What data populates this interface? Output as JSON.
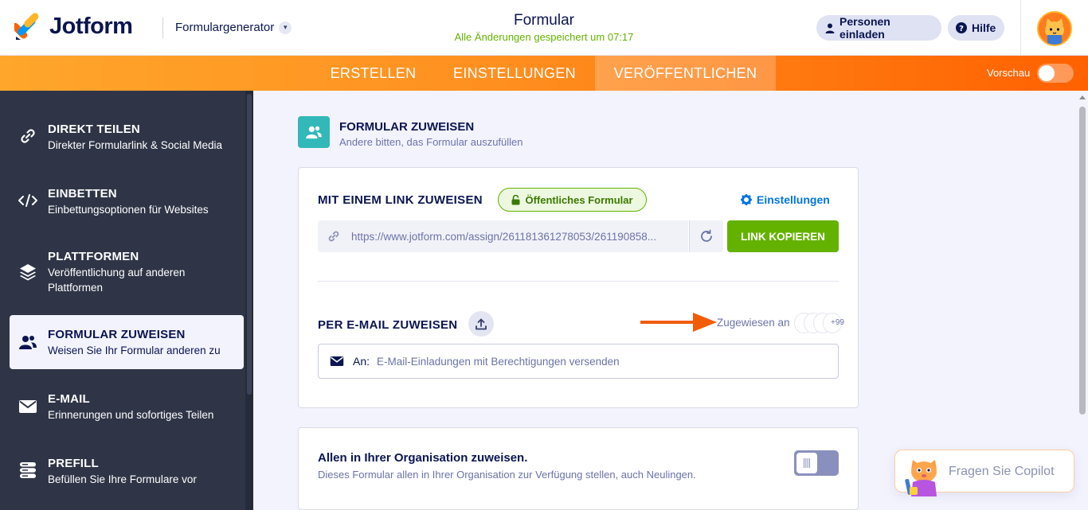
{
  "header": {
    "brand": "Jotform",
    "generator": "Formulargenerator",
    "form_title": "Formular",
    "saved_status": "Alle Änderungen gespeichert um 07:17",
    "invite_label": "Personen einladen",
    "help_label": "Hilfe"
  },
  "nav": {
    "tabs": [
      {
        "label": "ERSTELLEN"
      },
      {
        "label": "EINSTELLUNGEN"
      },
      {
        "label": "VERÖFFENTLICHEN"
      }
    ],
    "active_tab": "VERÖFFENTLICHEN",
    "preview_label": "Vorschau",
    "preview_on": false
  },
  "sidebar": {
    "items": [
      {
        "title": "DIREKT TEILEN",
        "subtitle": "Direkter Formularlink & Social Media",
        "icon": "link-icon"
      },
      {
        "title": "EINBETTEN",
        "subtitle": "Einbettungsoptionen für Websites",
        "icon": "code-icon"
      },
      {
        "title": "PLATTFORMEN",
        "subtitle": "Veröffentlichung auf anderen Plattformen",
        "subtitle_line1": "Veröffentlichung auf anderen",
        "subtitle_line2": "Plattformen",
        "icon": "layers-icon"
      },
      {
        "title": "FORMULAR ZUWEISEN",
        "subtitle": "Weisen Sie Ihr Formular anderen zu",
        "icon": "users-icon",
        "active": true
      },
      {
        "title": "E-MAIL",
        "subtitle": "Erinnerungen und sofortiges Teilen",
        "icon": "envelope-icon"
      },
      {
        "title": "PREFILL",
        "subtitle": "Befüllen Sie Ihre Formulare vor",
        "icon": "database-icon"
      }
    ]
  },
  "main": {
    "section_title": "FORMULAR ZUWEISEN",
    "section_subtitle": "Andere bitten, das Formular auszufüllen",
    "link_section": {
      "title": "MIT EINEM LINK ZUWEISEN",
      "badge": "Öffentliches Formular",
      "settings_label": "Einstellungen",
      "url": "https://www.jotform.com/assign/261181361278053/261190858...",
      "copy_label": "LINK KOPIEREN"
    },
    "email_section": {
      "title": "PER E-MAIL ZUWEISEN",
      "assigned_label": "Zugewiesen an",
      "assigned_more": "+99",
      "to_label": "An:",
      "to_placeholder": "E-Mail-Einladungen mit Berechtigungen versenden"
    },
    "org_section": {
      "title": "Allen in Ihrer Organisation zuweisen.",
      "subtitle": "Dieses Formular allen in Ihrer Organisation zur Verfügung stellen, auch Neulingen.",
      "enabled": false
    }
  },
  "copilot": {
    "label": "Fragen Sie Copilot"
  },
  "colors": {
    "navy": "#0a1551",
    "orange": "#ff6100",
    "green": "#64b200",
    "teal": "#32b8b8",
    "sidebar": "#2f3547",
    "link_blue": "#0075e3"
  }
}
